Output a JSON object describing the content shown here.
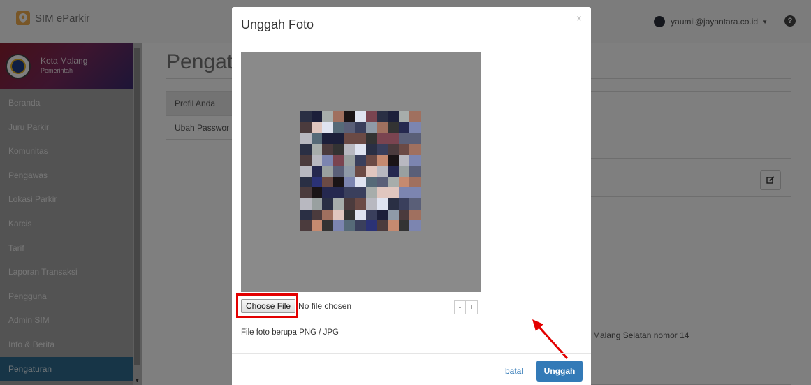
{
  "navbar": {
    "brand": "SIM eParkir",
    "user_email": "yaumil@jayantara.co.id",
    "help_label": "?"
  },
  "sidebar": {
    "org_name": "Kota Malang",
    "org_type": "Pemerintah",
    "items": [
      {
        "label": "Beranda"
      },
      {
        "label": "Juru Parkir"
      },
      {
        "label": "Komunitas"
      },
      {
        "label": "Pengawas"
      },
      {
        "label": "Lokasi Parkir"
      },
      {
        "label": "Karcis"
      },
      {
        "label": "Tarif"
      },
      {
        "label": "Laporan Transaksi"
      },
      {
        "label": "Pengguna"
      },
      {
        "label": "Admin SIM"
      },
      {
        "label": "Info & Berita"
      },
      {
        "label": "Pengaturan",
        "active": true
      }
    ]
  },
  "page": {
    "title": "Pengat",
    "tabs": [
      "Profil Anda",
      "Ubah Passwor"
    ],
    "address_fragment": "Malang Selatan nomor 14"
  },
  "modal": {
    "title": "Unggah Foto",
    "close_label": "×",
    "choose_file_label": "Choose File",
    "no_file_text": "No file chosen",
    "zoom_out_label": "-",
    "zoom_in_label": "+",
    "hint": "File foto berupa PNG / JPG",
    "cancel_label": "batal",
    "upload_label": "Unggah"
  },
  "colors": {
    "primary": "#337ab7",
    "sidebar_active": "#2e6b8f",
    "annotation": "#e30000",
    "brand_logo": "#f0ad4e"
  },
  "icons": {
    "brand": "map-pin-icon",
    "help": "question-circle-icon",
    "edit": "edit-icon"
  }
}
